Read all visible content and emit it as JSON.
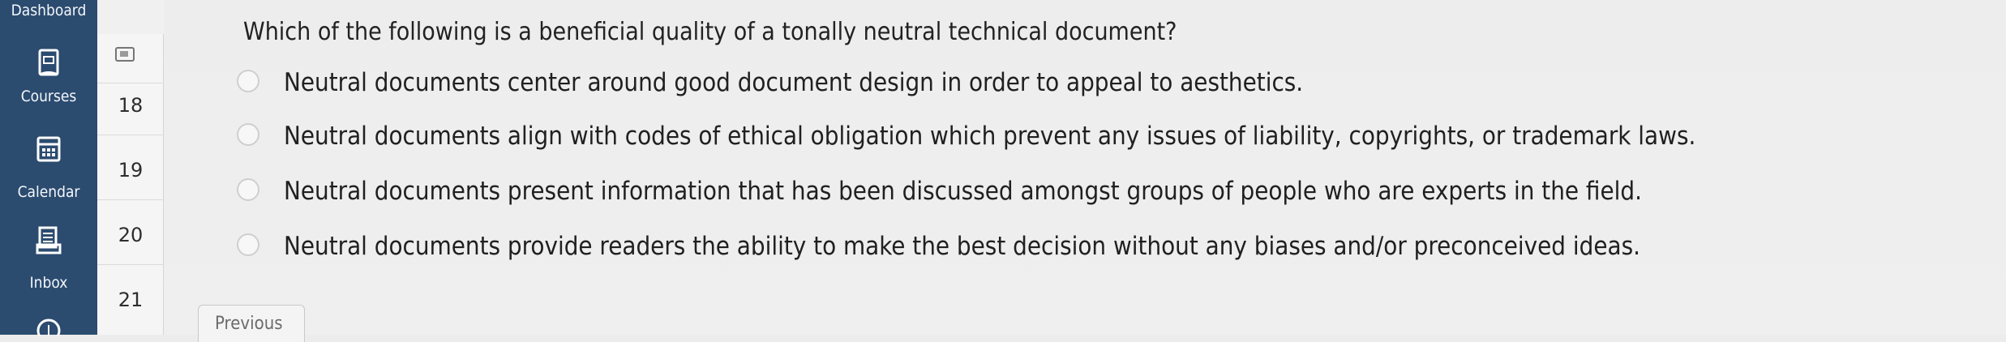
{
  "global_nav": {
    "dashboard_label": "Dashboard",
    "items": [
      {
        "label": "Courses",
        "icon": "book-icon"
      },
      {
        "label": "Calendar",
        "icon": "calendar-icon"
      },
      {
        "label": "Inbox",
        "icon": "inbox-icon"
      }
    ]
  },
  "course_nav": {
    "badges": [
      "18",
      "19",
      "20",
      "21"
    ]
  },
  "quiz": {
    "question": "Which of the following is a beneficial quality of a tonally neutral technical document?",
    "options": [
      "Neutral documents center around good document design in order to appeal to aesthetics.",
      "Neutral documents align with codes of ethical obligation which prevent any issues of liability, copyrights, or trademark laws.",
      "Neutral documents present information that has been discussed amongst groups of people who are experts in the field.",
      "Neutral documents provide readers the ability to make the best decision without any biases and/or preconceived ideas."
    ],
    "previous_label": "Previous"
  },
  "colors": {
    "nav_bg": "#2b4b6f",
    "content_bg": "#ededed",
    "text": "#222222",
    "radio_border": "#cfcfcf"
  }
}
